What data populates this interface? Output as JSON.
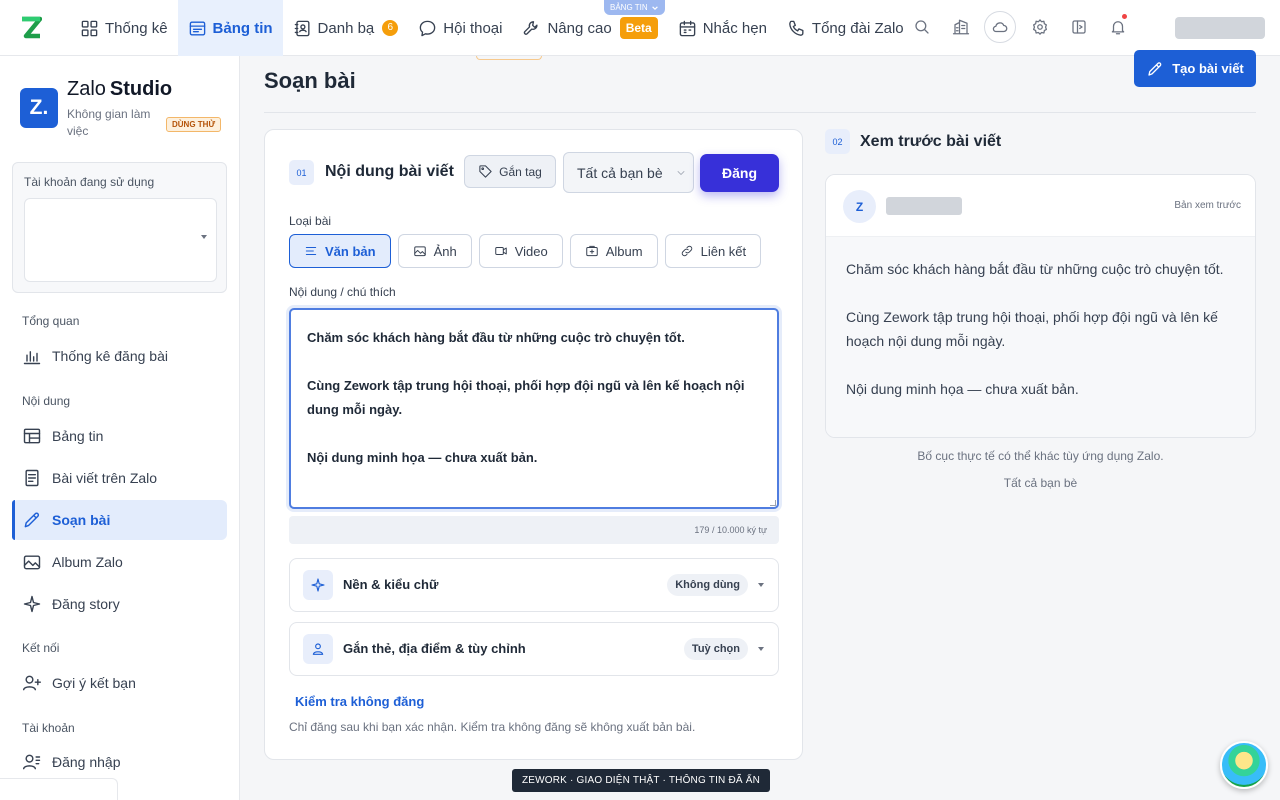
{
  "topbar": {
    "nav": [
      {
        "label": "Thống kê",
        "icon": "grid-icon"
      },
      {
        "label": "Bảng tin",
        "icon": "newsfeed-icon",
        "active": true
      },
      {
        "label": "Danh bạ",
        "icon": "contacts-icon",
        "badge": "6"
      },
      {
        "label": "Hội thoại",
        "icon": "chat-icon"
      },
      {
        "label": "Nâng cao",
        "icon": "tools-icon",
        "badge": "Beta"
      },
      {
        "label": "Nhắc hẹn",
        "icon": "calendar-icon"
      },
      {
        "label": "Tổng đài Zalo",
        "icon": "phone-icon"
      }
    ],
    "floating_tab": "BẢNG TIN",
    "icons": [
      "search-icon",
      "building-icon",
      "cloud-icon",
      "gear-icon",
      "panel-icon",
      "bell-icon"
    ]
  },
  "sidebar": {
    "brand": "Zalo",
    "brand_bold": "Studio",
    "logo_text": "Z.",
    "subtitle": "Không gian làm việc",
    "trial_badge": "DÙNG THỬ",
    "account_label": "Tài khoản đang sử dụng",
    "sections": {
      "overview": "Tổng quan",
      "content": "Nội dung",
      "connect": "Kết nối",
      "account": "Tài khoản"
    },
    "items": {
      "stats": "Thống kê đăng bài",
      "feed": "Bảng tin",
      "posts": "Bài viết trên Zalo",
      "compose": "Soạn bài",
      "album": "Album Zalo",
      "story": "Đăng story",
      "suggest": "Gợi ý kết bạn",
      "login": "Đăng nhập"
    }
  },
  "main": {
    "page_title": "Soạn bài",
    "create_button": "Tạo bài viết",
    "editor": {
      "step": "01",
      "title": "Nội dung bài viết",
      "tag_button": "Gắn tag",
      "audience": "Tất cả bạn bè",
      "post_button": "Đăng",
      "type_label": "Loại bài",
      "types": {
        "text": "Văn bản",
        "photo": "Ảnh",
        "video": "Video",
        "album": "Album",
        "link": "Liên kết"
      },
      "content_label": "Nội dung / chú thích",
      "content": "Chăm sóc khách hàng bắt đầu từ những cuộc trò chuyện tốt.\n\nCùng Zework tập trung hội thoại, phối hợp đội ngũ và lên kế hoạch nội dung mỗi ngày.\n\nNội dung minh họa — chưa xuất bản.",
      "char_count": "179 / 10.000 ký tự",
      "options": {
        "background_title": "Nền & kiểu chữ",
        "background_value": "Không dùng",
        "tags_title": "Gắn thẻ, địa điểm & tùy chỉnh",
        "tags_value": "Tuỳ chọn"
      },
      "dry_run_link": "Kiểm tra không đăng",
      "hint": "Chỉ đăng sau khi bạn xác nhận. Kiểm tra không đăng sẽ không xuất bản bài."
    },
    "preview": {
      "step": "02",
      "title": "Xem trước bài viết",
      "avatar": "Z",
      "preview_tag": "Bản xem trước",
      "body": "Chăm sóc khách hàng bắt đầu từ những cuộc trò chuyện tốt.\n\nCùng Zework tập trung hội thoại, phối hợp đội ngũ và lên kế hoạch nội dung mỗi ngày.\n\nNội dung minh họa — chưa xuất bản.",
      "note": "Bố cục thực tế có thể khác tùy ứng dụng Zalo.",
      "audience": "Tất cả bạn bè"
    }
  },
  "footer_tag": "ZEWORK · GIAO DIỆN THẬT · THÔNG TIN ĐÃ ẨN",
  "colors": {
    "accent": "#1d5fd6",
    "post_button": "#3730d9",
    "badge": "#f59e0b"
  }
}
